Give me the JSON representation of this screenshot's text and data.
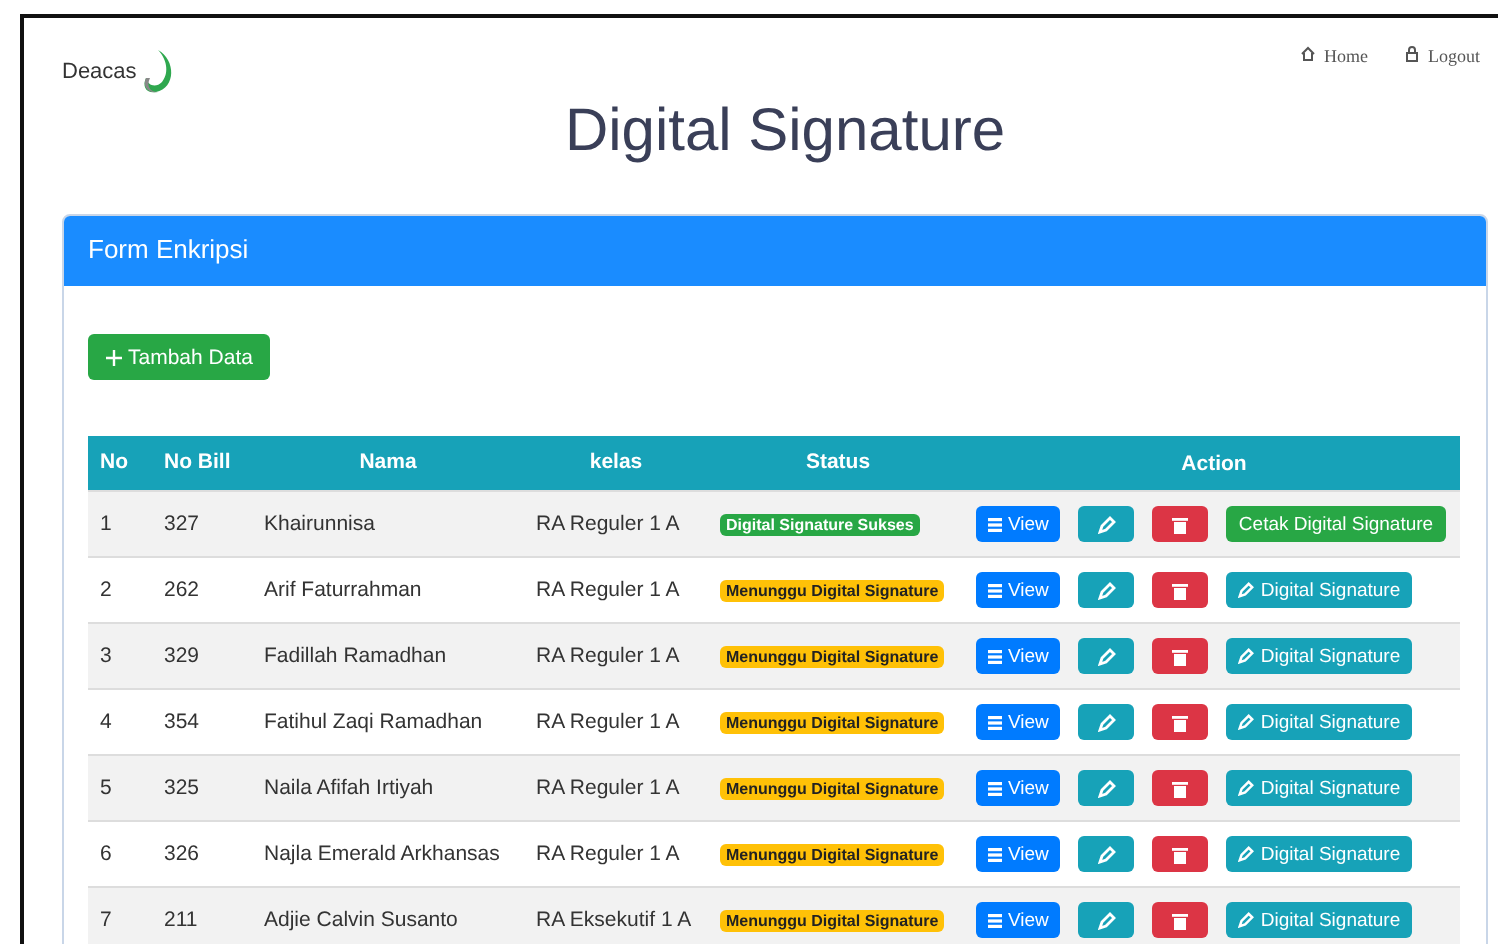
{
  "logo": {
    "text": "Deacas"
  },
  "nav": [
    {
      "kind": "home",
      "label": "Home"
    },
    {
      "kind": "logout",
      "label": "Logout"
    }
  ],
  "title": "Digital Signature",
  "card": {
    "title": "Form Enkripsi",
    "add_button": "Tambah Data"
  },
  "table": {
    "columns": [
      "No",
      "No Bill",
      "Nama",
      "kelas",
      "Status",
      "Action"
    ],
    "rows": [
      {
        "no": "1",
        "bill": "327",
        "nama": "Khairunnisa",
        "kelas": "RA Reguler 1 A",
        "status": {
          "kind": "success",
          "label": "Digital Signature Sukses"
        },
        "view": "View",
        "last": {
          "kind": "print",
          "label": "Cetak Digital Signature"
        }
      },
      {
        "no": "2",
        "bill": "262",
        "nama": "Arif Faturrahman",
        "kelas": "RA Reguler 1 A",
        "status": {
          "kind": "pending",
          "label": "Menunggu Digital Signature"
        },
        "view": "View",
        "last": {
          "kind": "sign",
          "label": "Digital Signature"
        }
      },
      {
        "no": "3",
        "bill": "329",
        "nama": "Fadillah Ramadhan",
        "kelas": "RA Reguler 1 A",
        "status": {
          "kind": "pending",
          "label": "Menunggu Digital Signature"
        },
        "view": "View",
        "last": {
          "kind": "sign",
          "label": "Digital Signature"
        }
      },
      {
        "no": "4",
        "bill": "354",
        "nama": "Fatihul Zaqi Ramadhan",
        "kelas": "RA Reguler 1 A",
        "status": {
          "kind": "pending",
          "label": "Menunggu Digital Signature"
        },
        "view": "View",
        "last": {
          "kind": "sign",
          "label": "Digital Signature"
        }
      },
      {
        "no": "5",
        "bill": "325",
        "nama": "Naila Afifah Irtiyah",
        "kelas": "RA Reguler 1 A",
        "status": {
          "kind": "pending",
          "label": "Menunggu Digital Signature"
        },
        "view": "View",
        "last": {
          "kind": "sign",
          "label": "Digital Signature"
        }
      },
      {
        "no": "6",
        "bill": "326",
        "nama": "Najla Emerald Arkhansas",
        "kelas": "RA Reguler 1 A",
        "status": {
          "kind": "pending",
          "label": "Menunggu Digital Signature"
        },
        "view": "View",
        "last": {
          "kind": "sign",
          "label": "Digital Signature"
        }
      },
      {
        "no": "7",
        "bill": "211",
        "nama": "Adjie Calvin Susanto",
        "kelas": "RA Eksekutif 1 A",
        "status": {
          "kind": "pending",
          "label": "Menunggu Digital Signature"
        },
        "view": "View",
        "last": {
          "kind": "sign",
          "label": "Digital Signature"
        }
      }
    ]
  }
}
